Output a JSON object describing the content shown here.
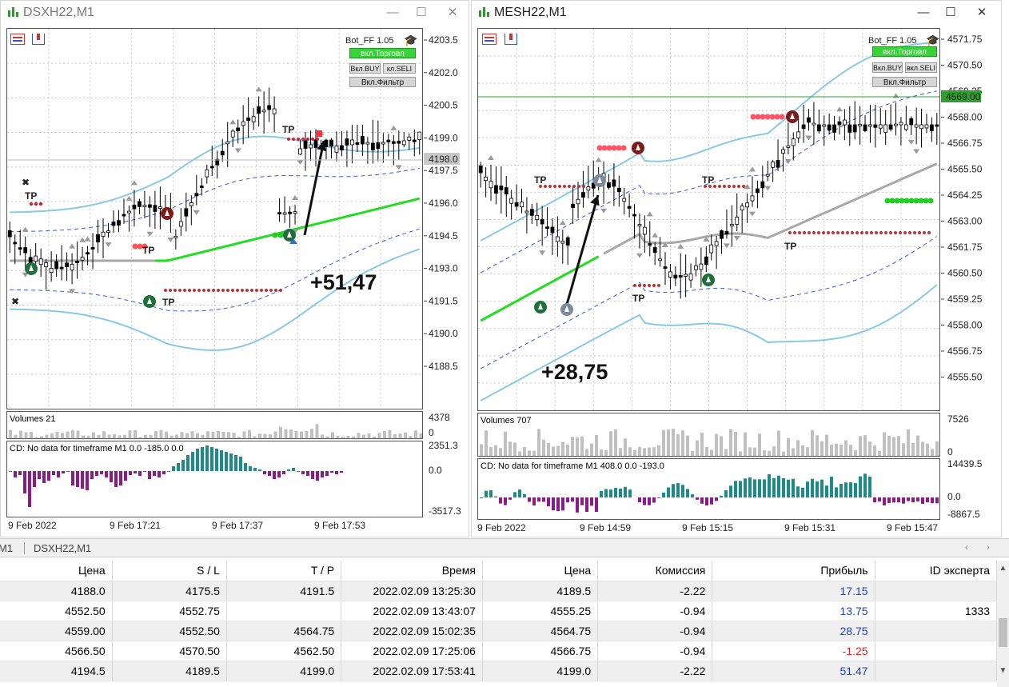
{
  "left_chart": {
    "title": "DSXH22,M1",
    "bot_label": "Bot_FF 1.05",
    "btn_trade": "вкл.Торговл",
    "btn_buy": "Вкл.BUY",
    "btn_sell": "кл.SELI",
    "btn_filter": "Вкл.Фильтр",
    "price_ticks": [
      "4203.5",
      "4202.0",
      "4200.5",
      "4199.0",
      "4197.5",
      "4196.0",
      "4194.5",
      "4193.0",
      "4191.5",
      "4190.0",
      "4188.5"
    ],
    "current_price": "4198.0",
    "profit_label": "+51,47",
    "tp_labels": [
      "TP",
      "TP",
      "TP",
      "TP"
    ],
    "volumes_label": "Volumes 21",
    "volumes_ticks": [
      "4378",
      "0"
    ],
    "cd_label": "CD: No data for timeframe M1 0.0 -185.0 0.0",
    "cd_ticks": [
      "2351.3",
      "0.0",
      "-3517.3"
    ],
    "time_labels": [
      "9 Feb 2022",
      "9 Feb 17:21",
      "9 Feb 17:37",
      "9 Feb 17:53"
    ]
  },
  "right_chart": {
    "title": "MESH22,M1",
    "bot_label": "Bot_FF 1.05",
    "btn_trade": "вкл.Торговл",
    "btn_buy": "Вкл.BUY",
    "btn_sell": "вкл.SELI",
    "btn_filter": "Вкл.Фильтр",
    "price_ticks": [
      "4571.75",
      "4570.50",
      "4569.25",
      "4568.00",
      "4566.75",
      "4565.50",
      "4564.25",
      "4563.00",
      "4561.75",
      "4560.50",
      "4559.25",
      "4558.00",
      "4556.75",
      "4555.50"
    ],
    "current_price": "4569.00",
    "profit_label": "+28,75",
    "tp_labels": [
      "TP",
      "TP",
      "TP",
      "TP"
    ],
    "volumes_label": "Volumes 707",
    "volumes_ticks": [
      "7526",
      "0"
    ],
    "cd_label": "CD: No data for timeframe M1 408.0 0.0 -193.0",
    "cd_ticks": [
      "14439.5",
      "0.0",
      "-8867.5"
    ],
    "time_labels": [
      "9 Feb 2022",
      "9 Feb 14:59",
      "9 Feb 15:15",
      "9 Feb 15:31",
      "9 Feb 15:47"
    ]
  },
  "tabs": [
    "M1",
    "DSXH22,M1"
  ],
  "table": {
    "headers": [
      "Цена",
      "S / L",
      "T / P",
      "Время",
      "Цена",
      "Комиссия",
      "Прибыль",
      "ID эксперта"
    ],
    "rows": [
      [
        "4188.0",
        "4175.5",
        "4191.5",
        "2022.02.09 13:25:30",
        "4189.5",
        "-2.22",
        "17.15",
        ""
      ],
      [
        "4552.50",
        "4552.75",
        "",
        "2022.02.09 13:43:07",
        "4555.25",
        "-0.94",
        "13.75",
        "1333"
      ],
      [
        "4559.00",
        "4552.50",
        "4564.75",
        "2022.02.09 15:02:35",
        "4564.75",
        "-0.94",
        "28.75",
        ""
      ],
      [
        "4566.50",
        "4570.50",
        "4562.50",
        "2022.02.09 17:25:06",
        "4566.75",
        "-0.94",
        "-1.25",
        ""
      ],
      [
        "4194.5",
        "4189.5",
        "4199.0",
        "2022.02.09 17:53:41",
        "4199.0",
        "-2.22",
        "51.47",
        ""
      ]
    ]
  },
  "colors": {
    "tp_highlight": "#5de65d",
    "profit_pos": "#1f3fcf",
    "profit_neg": "#e02020",
    "ma_green": "#22dd22",
    "bands": "#87c9e6"
  }
}
